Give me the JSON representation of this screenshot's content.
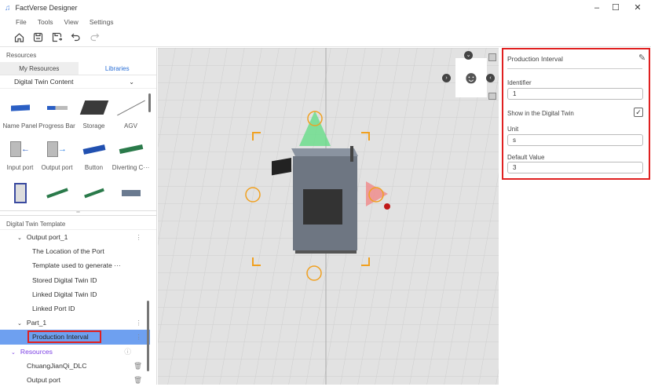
{
  "app": {
    "title": "FactVerse Designer",
    "window_controls": [
      "minimize",
      "maximize",
      "close"
    ]
  },
  "menu": [
    "File",
    "Tools",
    "View",
    "Settings"
  ],
  "toolbar": [
    "home-icon",
    "save-icon",
    "save-as-icon",
    "undo-icon",
    "redo-icon"
  ],
  "left": {
    "resources_title": "Resources",
    "tabs": [
      {
        "label": "My Resources",
        "active": false
      },
      {
        "label": "Libraries",
        "active": true
      }
    ],
    "category": "Digital Twin Content",
    "items": [
      {
        "label": "Name Panel"
      },
      {
        "label": "Progress Bar"
      },
      {
        "label": "Storage"
      },
      {
        "label": "AGV"
      },
      {
        "label": "Input port"
      },
      {
        "label": "Output port"
      },
      {
        "label": "Button"
      },
      {
        "label": "Diverting C···"
      },
      {
        "label": ""
      },
      {
        "label": ""
      },
      {
        "label": ""
      },
      {
        "label": ""
      }
    ],
    "template_title": "Digital Twin Template",
    "tree": [
      {
        "label": "Output port_1",
        "level": 1,
        "expand": true,
        "menu": true
      },
      {
        "label": "The Location of the Port",
        "level": 2
      },
      {
        "label": "Template used to generate ···",
        "level": 2
      },
      {
        "label": "Stored Digital Twin ID",
        "level": 2
      },
      {
        "label": "Linked Digital Twin ID",
        "level": 2
      },
      {
        "label": "Linked Port ID",
        "level": 2
      },
      {
        "label": "Part_1",
        "level": 1,
        "expand": true,
        "menu": true
      },
      {
        "label": "Production Interval",
        "level": 2,
        "selected": true,
        "menu": true
      }
    ],
    "resources_group": "Resources",
    "resource_items": [
      "ChuangJianQi_DLC",
      "Output port"
    ]
  },
  "props": {
    "title": "Production Interval",
    "identifier_label": "Identifier",
    "identifier_value": "1",
    "show_label": "Show in the Digital Twin",
    "show_checked": true,
    "unit_label": "Unit",
    "unit_value": "s",
    "default_label": "Default Value",
    "default_value": "3"
  },
  "colors": {
    "accent": "#2a6fd6",
    "selected": "#6ea0f0",
    "highlight": "#e02020",
    "gizmo": "#f0a020",
    "purple": "#7b3fe4"
  }
}
